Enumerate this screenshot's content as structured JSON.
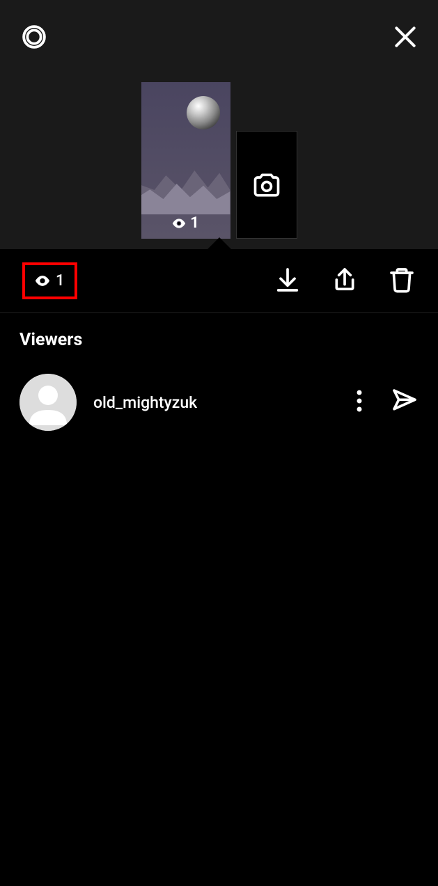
{
  "story": {
    "views_count": "1",
    "thumb_views_count": "1"
  },
  "viewers_section": {
    "title": "Viewers",
    "items": [
      {
        "username": "old_mightyzuk"
      }
    ]
  },
  "icons": {
    "settings": "settings-icon",
    "close": "close-icon",
    "eye": "eye-icon",
    "camera": "camera-icon",
    "download": "download-icon",
    "share": "share-icon",
    "trash": "trash-icon",
    "more": "more-icon",
    "send": "send-icon"
  }
}
